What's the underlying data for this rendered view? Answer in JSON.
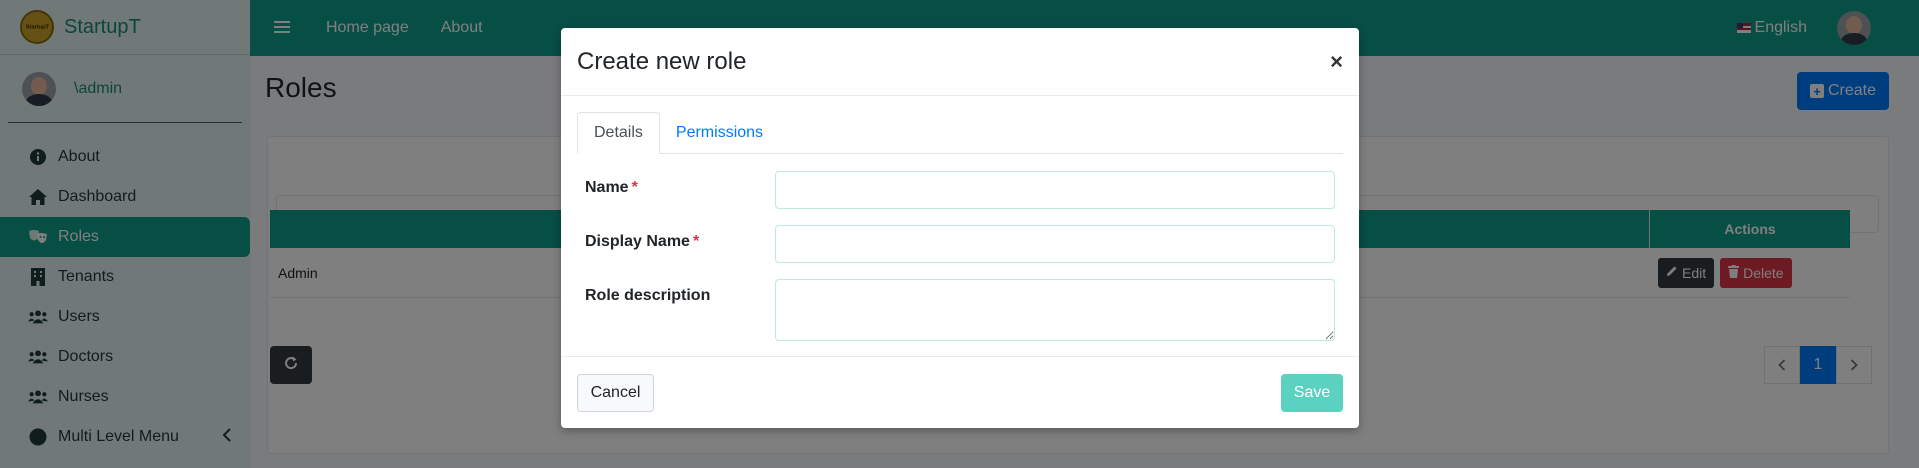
{
  "brand": {
    "name": "StartupT",
    "logo_text": "StartupT"
  },
  "user": {
    "name": "\\admin"
  },
  "sidebar": {
    "items": [
      {
        "label": "About",
        "icon": "info-circle-icon"
      },
      {
        "label": "Dashboard",
        "icon": "home-icon"
      },
      {
        "label": "Roles",
        "icon": "theater-masks-icon",
        "active": true
      },
      {
        "label": "Tenants",
        "icon": "building-icon"
      },
      {
        "label": "Users",
        "icon": "users-icon"
      },
      {
        "label": "Doctors",
        "icon": "users-icon"
      },
      {
        "label": "Nurses",
        "icon": "users-icon"
      },
      {
        "label": "Multi Level Menu",
        "icon": "circle-icon",
        "has_submenu": true
      }
    ]
  },
  "topbar": {
    "links": [
      "Home page",
      "About"
    ],
    "language": "English"
  },
  "page": {
    "title": "Roles",
    "create_label": "Create",
    "table": {
      "headers": [
        "",
        "Actions"
      ],
      "rows": [
        {
          "name": "Admin"
        }
      ],
      "edit_label": "Edit",
      "delete_label": "Delete"
    },
    "pagination": {
      "current": "1"
    }
  },
  "modal": {
    "title": "Create new role",
    "tabs": [
      "Details",
      "Permissions"
    ],
    "fields": {
      "name_label": "Name",
      "display_name_label": "Display Name",
      "description_label": "Role description",
      "required_mark": "*"
    },
    "cancel_label": "Cancel",
    "save_label": "Save"
  },
  "colors": {
    "primary": "#0f9c8a",
    "blue": "#007bff",
    "danger": "#dc3545",
    "dark": "#343a40"
  }
}
